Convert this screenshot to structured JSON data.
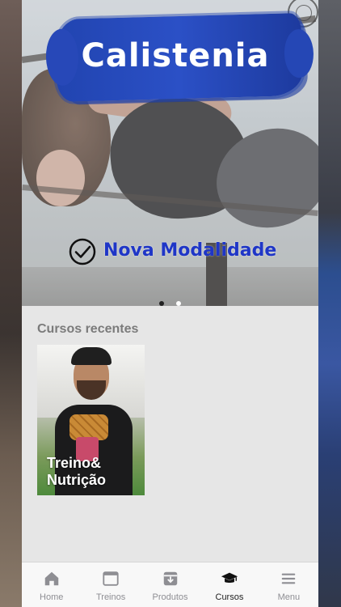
{
  "banner": {
    "title": "Calistenia",
    "subtitle": "Nova Modalidade",
    "slides_total": 2,
    "active_slide": 1
  },
  "courses": {
    "section_title": "Cursos recentes",
    "items": [
      {
        "title_line1": "Treino&",
        "title_line2": "Nutrição"
      }
    ]
  },
  "tabbar": {
    "items": [
      {
        "label": "Home",
        "icon": "home-icon",
        "active": false
      },
      {
        "label": "Treinos",
        "icon": "window-icon",
        "active": false
      },
      {
        "label": "Produtos",
        "icon": "archive-box-icon",
        "active": false
      },
      {
        "label": "Cursos",
        "icon": "graduation-cap-icon",
        "active": true
      },
      {
        "label": "Menu",
        "icon": "hamburger-menu-icon",
        "active": false
      }
    ]
  },
  "colors": {
    "brand_blue": "#2144b0",
    "subtitle_blue": "#1f36c7",
    "tab_inactive": "#8e8e93",
    "tab_active": "#222222"
  }
}
